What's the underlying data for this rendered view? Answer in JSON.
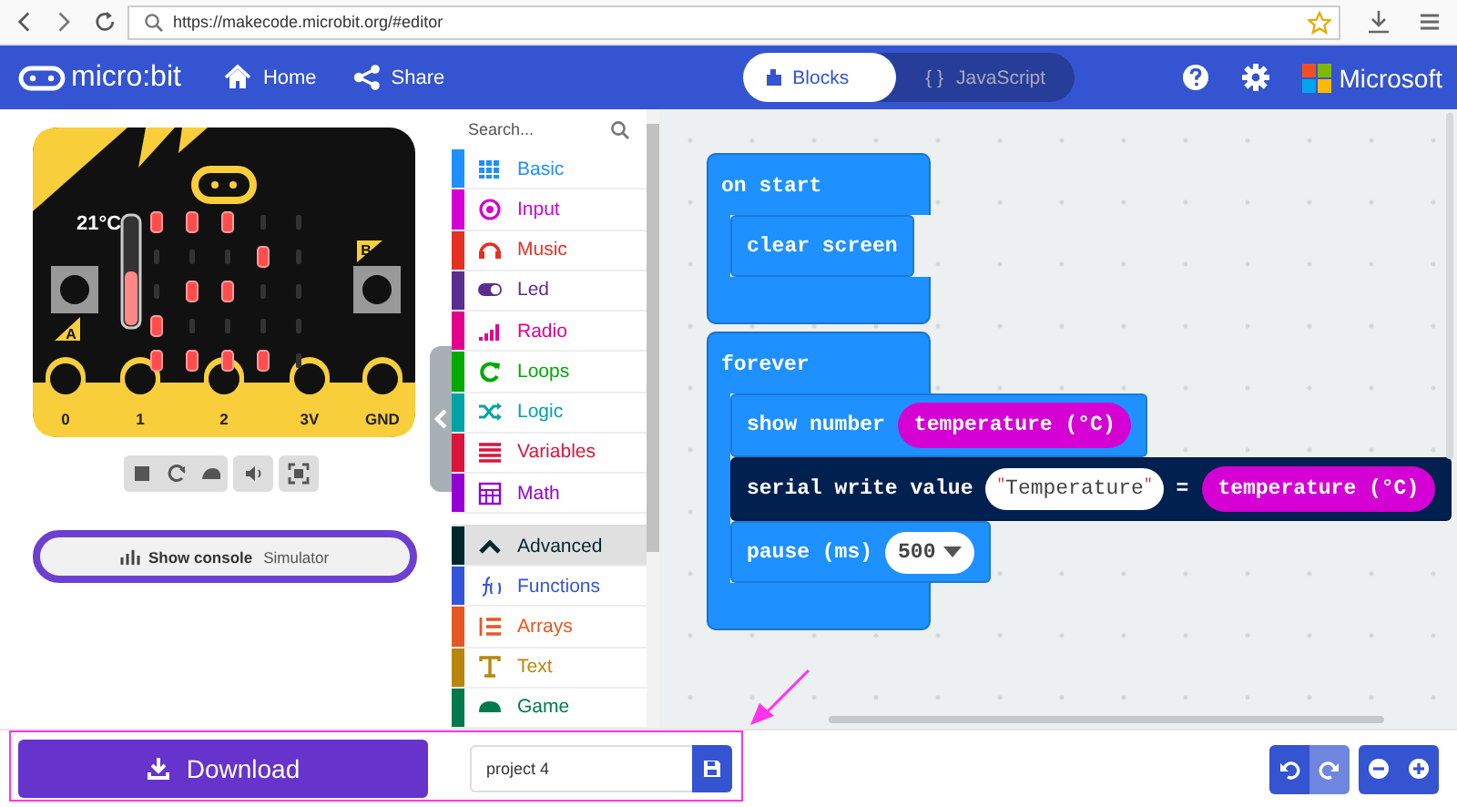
{
  "browser": {
    "url": "https://makecode.microbit.org/#editor"
  },
  "header": {
    "logo": "micro:bit",
    "nav": [
      {
        "kind": "home",
        "label": "Home"
      },
      {
        "kind": "share",
        "label": "Share"
      }
    ],
    "tabs": [
      {
        "kind": "blocks",
        "label": "Blocks",
        "selected": true
      },
      {
        "kind": "javascript",
        "icon": "{ }",
        "label": "JavaScript",
        "selected": false
      }
    ],
    "brand": "Microsoft"
  },
  "simulator": {
    "temperature": "21°C",
    "thermometer": {
      "level": 0.5
    },
    "leds": [
      [
        true,
        true,
        true,
        false,
        false
      ],
      [
        false,
        false,
        false,
        true,
        false
      ],
      [
        false,
        true,
        true,
        false,
        false
      ],
      [
        true,
        false,
        false,
        false,
        false
      ],
      [
        true,
        true,
        true,
        true,
        false
      ]
    ],
    "button_labels": [
      "A",
      "B"
    ],
    "pins": [
      "0",
      "1",
      "2",
      "3V",
      "GND"
    ],
    "console_button": {
      "label": "Show console",
      "suffix": "Simulator"
    }
  },
  "toolbox": {
    "search": {
      "placeholder": "Search..."
    },
    "categories": [
      {
        "kind": "basic",
        "label": "Basic",
        "color": "#1e90ff",
        "selected": false
      },
      {
        "kind": "input",
        "label": "Input",
        "color": "#d400d4",
        "selected": false
      },
      {
        "kind": "music",
        "label": "Music",
        "color": "#e63022",
        "selected": false
      },
      {
        "kind": "led",
        "label": "Led",
        "color": "#5c2d91",
        "selected": false
      },
      {
        "kind": "radio",
        "label": "Radio",
        "color": "#e3008c",
        "selected": false
      },
      {
        "kind": "loops",
        "label": "Loops",
        "color": "#00aa00",
        "selected": false
      },
      {
        "kind": "logic",
        "label": "Logic",
        "color": "#00a4a6",
        "selected": false
      },
      {
        "kind": "variables",
        "label": "Variables",
        "color": "#dc143c",
        "selected": false
      },
      {
        "kind": "math",
        "label": "Math",
        "color": "#9400d3",
        "selected": false
      }
    ],
    "more_categories": [
      {
        "kind": "advanced",
        "label": "Advanced",
        "color": "#00272b",
        "selected": true
      },
      {
        "kind": "functions",
        "label": "Functions",
        "color": "#3455db",
        "selected": false
      },
      {
        "kind": "arrays",
        "label": "Arrays",
        "color": "#e65722",
        "selected": false
      },
      {
        "kind": "text",
        "label": "Text",
        "color": "#b8860b",
        "selected": false
      },
      {
        "kind": "game",
        "label": "Game",
        "color": "#007a4b",
        "selected": false
      }
    ]
  },
  "workspace": {
    "stacks": [
      {
        "label": "on start",
        "body": [
          {
            "color": "#1e90ff",
            "parts": [
              {
                "kind": "label",
                "text": "clear screen"
              }
            ]
          }
        ]
      },
      {
        "label": "forever",
        "body": [
          {
            "color": "#1e90ff",
            "parts": [
              {
                "kind": "label",
                "text": "show number"
              },
              {
                "kind": "reporter",
                "text": "temperature (°C)",
                "color": "#d400d4"
              }
            ]
          },
          {
            "color": "#002050",
            "parts": [
              {
                "kind": "label",
                "text": "serial write value"
              },
              {
                "kind": "string",
                "open": "\"",
                "text": "Temperature",
                "close": "\""
              },
              {
                "kind": "label",
                "text": "="
              },
              {
                "kind": "reporter",
                "text": "temperature (°C)",
                "color": "#d400d4"
              }
            ]
          },
          {
            "color": "#1e90ff",
            "parts": [
              {
                "kind": "label",
                "text": "pause (ms)"
              },
              {
                "kind": "dropdown",
                "text": "500"
              }
            ]
          }
        ]
      }
    ]
  },
  "bottom": {
    "download": "Download",
    "project": {
      "value": "project 4"
    },
    "edit_buttons": [
      {
        "kind": "undo",
        "disabled": false
      },
      {
        "kind": "redo",
        "disabled": true
      }
    ]
  }
}
